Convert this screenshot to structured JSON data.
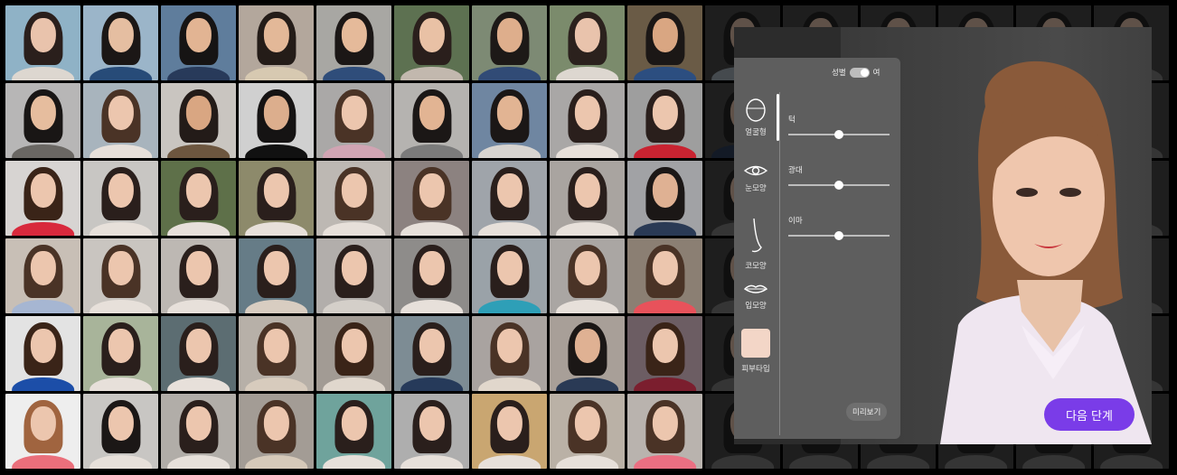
{
  "face_grid": {
    "tiles": [
      {
        "bg": "#8fb2c6",
        "skin": "#e9c3ac",
        "hair": "#2a1f1c",
        "top": "#ddd7d0"
      },
      {
        "bg": "#9bb5c9",
        "skin": "#e5bea1",
        "hair": "#1b1716",
        "top": "#274b78"
      },
      {
        "bg": "#5f7d9c",
        "skin": "#e2b493",
        "hair": "#161414",
        "top": "#283a5a"
      },
      {
        "bg": "#b3a79c",
        "skin": "#e3b898",
        "hair": "#241c18",
        "top": "#d7c9b1"
      },
      {
        "bg": "#a8a7a3",
        "skin": "#e5ba9a",
        "hair": "#1b1716",
        "top": "#2f4d7a"
      },
      {
        "bg": "#5d7151",
        "skin": "#e9c1a5",
        "hair": "#2a1f1c",
        "top": "#c2b8ae"
      },
      {
        "bg": "#7d8a74",
        "skin": "#deae8c",
        "hair": "#1d1917",
        "top": "#314b76"
      },
      {
        "bg": "#7b8b6c",
        "skin": "#e9c3ac",
        "hair": "#2b211d",
        "top": "#ddd7d0"
      },
      {
        "bg": "#6a5b46",
        "skin": "#d9a682",
        "hair": "#1b1716",
        "top": "#2c4e80"
      },
      {
        "bg": "#444",
        "skin": "#d2b39f",
        "hair": "#222",
        "top": "#9aa4ad"
      },
      {
        "bg": "#444",
        "skin": "#d2b39f",
        "hair": "#222",
        "top": "#777"
      },
      {
        "bg": "#444",
        "skin": "#d2b39f",
        "hair": "#222",
        "top": "#777"
      },
      {
        "bg": "#444",
        "skin": "#d2b39f",
        "hair": "#222",
        "top": "#777"
      },
      {
        "bg": "#444",
        "skin": "#d2b39f",
        "hair": "#222",
        "top": "#777"
      },
      {
        "bg": "#444",
        "skin": "#d2b39f",
        "hair": "#222",
        "top": "#777"
      },
      {
        "bg": "#b7b6b6",
        "skin": "#e6bd9e",
        "hair": "#191615",
        "top": "#6a6763"
      },
      {
        "bg": "#a8b4bd",
        "skin": "#ecc6ae",
        "hair": "#4a3326",
        "top": "#e7e0da"
      },
      {
        "bg": "#c9c5c0",
        "skin": "#d9a682",
        "hair": "#231b18",
        "top": "#6d563f"
      },
      {
        "bg": "#d0d0d0",
        "skin": "#dcae8d",
        "hair": "#151313",
        "top": "#111"
      },
      {
        "bg": "#aaa8a7",
        "skin": "#ecc6ae",
        "hair": "#4a3326",
        "top": "#d1a4b3"
      },
      {
        "bg": "#b5b3b0",
        "skin": "#e2b493",
        "hair": "#1b1716",
        "top": "#7b7b7b"
      },
      {
        "bg": "#6f86a1",
        "skin": "#e2b493",
        "hair": "#1b1716",
        "top": "#d7d4d0"
      },
      {
        "bg": "#a9a7a6",
        "skin": "#ecc6ae",
        "hair": "#2a1f1c",
        "top": "#e7e0da"
      },
      {
        "bg": "#9e9e9e",
        "skin": "#ecc6ae",
        "hair": "#2a1f1c",
        "top": "#c92331"
      },
      {
        "bg": "#444",
        "skin": "#d2b39f",
        "hair": "#222",
        "top": "#2a3a55"
      },
      {
        "bg": "#444",
        "skin": "#d2b39f",
        "hair": "#222",
        "top": "#777"
      },
      {
        "bg": "#444",
        "skin": "#d2b39f",
        "hair": "#222",
        "top": "#777"
      },
      {
        "bg": "#444",
        "skin": "#d2b39f",
        "hair": "#222",
        "top": "#777"
      },
      {
        "bg": "#444",
        "skin": "#d2b39f",
        "hair": "#222",
        "top": "#777"
      },
      {
        "bg": "#444",
        "skin": "#d2b39f",
        "hair": "#222",
        "top": "#777"
      },
      {
        "bg": "#d7d4d2",
        "skin": "#ecc6ae",
        "hair": "#3a2418",
        "top": "#d8293c"
      },
      {
        "bg": "#c8c6c3",
        "skin": "#ecc6ae",
        "hair": "#2a1f1c",
        "top": "#e7e0da"
      },
      {
        "bg": "#5e7049",
        "skin": "#ecc6ae",
        "hair": "#2a1f1c",
        "top": "#e7e0da"
      },
      {
        "bg": "#8d8a6b",
        "skin": "#ecc6ae",
        "hair": "#2a1f1c",
        "top": "#e7e0da"
      },
      {
        "bg": "#bdb8b3",
        "skin": "#ecc6ae",
        "hair": "#4a3326",
        "top": "#e7e0da"
      },
      {
        "bg": "#8c8280",
        "skin": "#ecc6ae",
        "hair": "#4a3326",
        "top": "#e7e0da"
      },
      {
        "bg": "#9fa4aa",
        "skin": "#ecc6ae",
        "hair": "#2a1f1c",
        "top": "#e7e0da"
      },
      {
        "bg": "#a9a4a0",
        "skin": "#ecc6ae",
        "hair": "#2a1f1c",
        "top": "#e7e0da"
      },
      {
        "bg": "#a1a2a5",
        "skin": "#dfb193",
        "hair": "#1b1716",
        "top": "#2a3a55"
      },
      {
        "bg": "#444",
        "skin": "#d2b39f",
        "hair": "#222",
        "top": "#777"
      },
      {
        "bg": "#444",
        "skin": "#d2b39f",
        "hair": "#222",
        "top": "#777"
      },
      {
        "bg": "#444",
        "skin": "#d2b39f",
        "hair": "#222",
        "top": "#777"
      },
      {
        "bg": "#444",
        "skin": "#d2b39f",
        "hair": "#222",
        "top": "#777"
      },
      {
        "bg": "#444",
        "skin": "#d2b39f",
        "hair": "#222",
        "top": "#777"
      },
      {
        "bg": "#444",
        "skin": "#d2b39f",
        "hair": "#222",
        "top": "#777"
      },
      {
        "bg": "#c8bfb6",
        "skin": "#ecc6ae",
        "hair": "#4a3326",
        "top": "#a6b6d2"
      },
      {
        "bg": "#c9c5c0",
        "skin": "#ecc6ae",
        "hair": "#4a3326",
        "top": "#e7e0da"
      },
      {
        "bg": "#bdb8b3",
        "skin": "#ecc6ae",
        "hair": "#2a1f1c",
        "top": "#e7e0da"
      },
      {
        "bg": "#667c87",
        "skin": "#ecc6ae",
        "hair": "#2a1f1c",
        "top": "#d8cdc1"
      },
      {
        "bg": "#b2aeab",
        "skin": "#ecc6ae",
        "hair": "#2a1f1c",
        "top": "#d4cfc9"
      },
      {
        "bg": "#8e8c8a",
        "skin": "#ecc6ae",
        "hair": "#2a1f1c",
        "top": "#e7e0da"
      },
      {
        "bg": "#9aa2a8",
        "skin": "#ecc6ae",
        "hair": "#2a1f1c",
        "top": "#2e9fb7"
      },
      {
        "bg": "#aaa6a3",
        "skin": "#ecc6ae",
        "hair": "#4a3326",
        "top": "#e7e0da"
      },
      {
        "bg": "#8b7f73",
        "skin": "#ecc6ae",
        "hair": "#4a3326",
        "top": "#e8525b"
      },
      {
        "bg": "#444",
        "skin": "#d2b39f",
        "hair": "#222",
        "top": "#777"
      },
      {
        "bg": "#444",
        "skin": "#d2b39f",
        "hair": "#222",
        "top": "#777"
      },
      {
        "bg": "#444",
        "skin": "#d2b39f",
        "hair": "#222",
        "top": "#777"
      },
      {
        "bg": "#444",
        "skin": "#d2b39f",
        "hair": "#222",
        "top": "#777"
      },
      {
        "bg": "#444",
        "skin": "#d2b39f",
        "hair": "#222",
        "top": "#777"
      },
      {
        "bg": "#444",
        "skin": "#d2b39f",
        "hair": "#222",
        "top": "#777"
      },
      {
        "bg": "#e3e3e3",
        "skin": "#ecc6ae",
        "hair": "#3a2418",
        "top": "#1c4ea8"
      },
      {
        "bg": "#a8b49a",
        "skin": "#ecc6ae",
        "hair": "#2a1f1c",
        "top": "#e7e0da"
      },
      {
        "bg": "#5c6d72",
        "skin": "#ecc6ae",
        "hair": "#2a1f1c",
        "top": "#e7e0da"
      },
      {
        "bg": "#b7b0a8",
        "skin": "#ecc6ae",
        "hair": "#4a3326",
        "top": "#d7cbbd"
      },
      {
        "bg": "#a29b94",
        "skin": "#ecc6ae",
        "hair": "#3a2418",
        "top": "#e0d7cd"
      },
      {
        "bg": "#7d8c94",
        "skin": "#ecc6ae",
        "hair": "#2a1f1c",
        "top": "#263a5a"
      },
      {
        "bg": "#a9a3a0",
        "skin": "#ecc6ae",
        "hair": "#4a3326",
        "top": "#e1d7cc"
      },
      {
        "bg": "#a89f98",
        "skin": "#dfb193",
        "hair": "#1b1716",
        "top": "#2a3a55"
      },
      {
        "bg": "#6c5d63",
        "skin": "#ecc6ae",
        "hair": "#3a2418",
        "top": "#7b1e2e"
      },
      {
        "bg": "#444",
        "skin": "#d2b39f",
        "hair": "#222",
        "top": "#777"
      },
      {
        "bg": "#444",
        "skin": "#d2b39f",
        "hair": "#222",
        "top": "#777"
      },
      {
        "bg": "#444",
        "skin": "#d2b39f",
        "hair": "#222",
        "top": "#777"
      },
      {
        "bg": "#444",
        "skin": "#d2b39f",
        "hair": "#222",
        "top": "#777"
      },
      {
        "bg": "#444",
        "skin": "#d2b39f",
        "hair": "#222",
        "top": "#777"
      },
      {
        "bg": "#444",
        "skin": "#d2b39f",
        "hair": "#222",
        "top": "#777"
      },
      {
        "bg": "#eeeeee",
        "skin": "#ecc6ae",
        "hair": "#a0643f",
        "top": "#ea6f7b"
      },
      {
        "bg": "#c8c6c3",
        "skin": "#ecc6ae",
        "hair": "#1b1716",
        "top": "#e7e0da"
      },
      {
        "bg": "#b1ada8",
        "skin": "#ecc6ae",
        "hair": "#2a1f1c",
        "top": "#e7e0da"
      },
      {
        "bg": "#a39c95",
        "skin": "#ecc6ae",
        "hair": "#4a3326",
        "top": "#d6c9b9"
      },
      {
        "bg": "#6fa39c",
        "skin": "#ecc6ae",
        "hair": "#2a1f1c",
        "top": "#e7e0da"
      },
      {
        "bg": "#aeaeae",
        "skin": "#ecc6ae",
        "hair": "#2a1f1c",
        "top": "#e7e0da"
      },
      {
        "bg": "#c9a671",
        "skin": "#ecc6ae",
        "hair": "#2a1f1c",
        "top": "#e7e0da"
      },
      {
        "bg": "#bab1a6",
        "skin": "#ecc6ae",
        "hair": "#4a3326",
        "top": "#e7e0da"
      },
      {
        "bg": "#b9b3ae",
        "skin": "#ecc6ae",
        "hair": "#4a3326",
        "top": "#eb6f82"
      },
      {
        "bg": "#444",
        "skin": "#d2b39f",
        "hair": "#222",
        "top": "#777"
      },
      {
        "bg": "#444",
        "skin": "#d2b39f",
        "hair": "#222",
        "top": "#777"
      },
      {
        "bg": "#444",
        "skin": "#d2b39f",
        "hair": "#222",
        "top": "#777"
      },
      {
        "bg": "#444",
        "skin": "#d2b39f",
        "hair": "#222",
        "top": "#777"
      },
      {
        "bg": "#444",
        "skin": "#d2b39f",
        "hair": "#222",
        "top": "#777"
      },
      {
        "bg": "#444",
        "skin": "#d2b39f",
        "hair": "#222",
        "top": "#777"
      }
    ]
  },
  "editor": {
    "gender_label": "성별",
    "gender_value": "여",
    "menu": [
      {
        "label": "얼굴형",
        "icon": "face-outline-icon",
        "active": true
      },
      {
        "label": "눈모양",
        "icon": "eye-icon",
        "active": false
      },
      {
        "label": "코모양",
        "icon": "nose-icon",
        "active": false
      },
      {
        "label": "입모양",
        "icon": "lips-icon",
        "active": false
      },
      {
        "label": "피부타입",
        "icon": "skin-swatch-icon",
        "active": false
      }
    ],
    "sliders": [
      {
        "label": "턱",
        "value": 0.5
      },
      {
        "label": "광대",
        "value": 0.5
      },
      {
        "label": "이마",
        "value": 0.5
      }
    ],
    "skin_color": "#f3d6c7",
    "preview_button": "미리보기",
    "next_button": "다음 단계",
    "accent_color": "#7a3ce8"
  }
}
